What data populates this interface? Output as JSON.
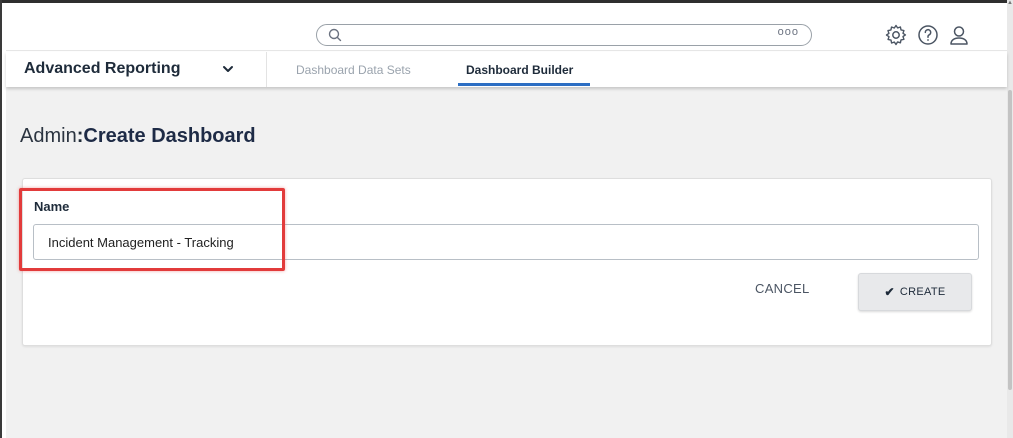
{
  "search": {
    "placeholder": "",
    "options_glyph": "ooo"
  },
  "header_icons": [
    "gear-icon",
    "help-icon",
    "user-icon"
  ],
  "app": {
    "title": "Advanced Reporting"
  },
  "tabs": [
    {
      "label": "Dashboard Data Sets",
      "active": false
    },
    {
      "label": "Dashboard Builder",
      "active": true
    }
  ],
  "page": {
    "prefix": "Admin",
    "separator": ":",
    "title": "Create Dashboard"
  },
  "form": {
    "name_label": "Name",
    "name_value": "Incident Management - Tracking",
    "cancel_label": "CANCEL",
    "create_label": "CREATE"
  },
  "colors": {
    "accent": "#2d6fc4",
    "highlight": "#e23b3b",
    "content_bg": "#f1f1f1"
  }
}
